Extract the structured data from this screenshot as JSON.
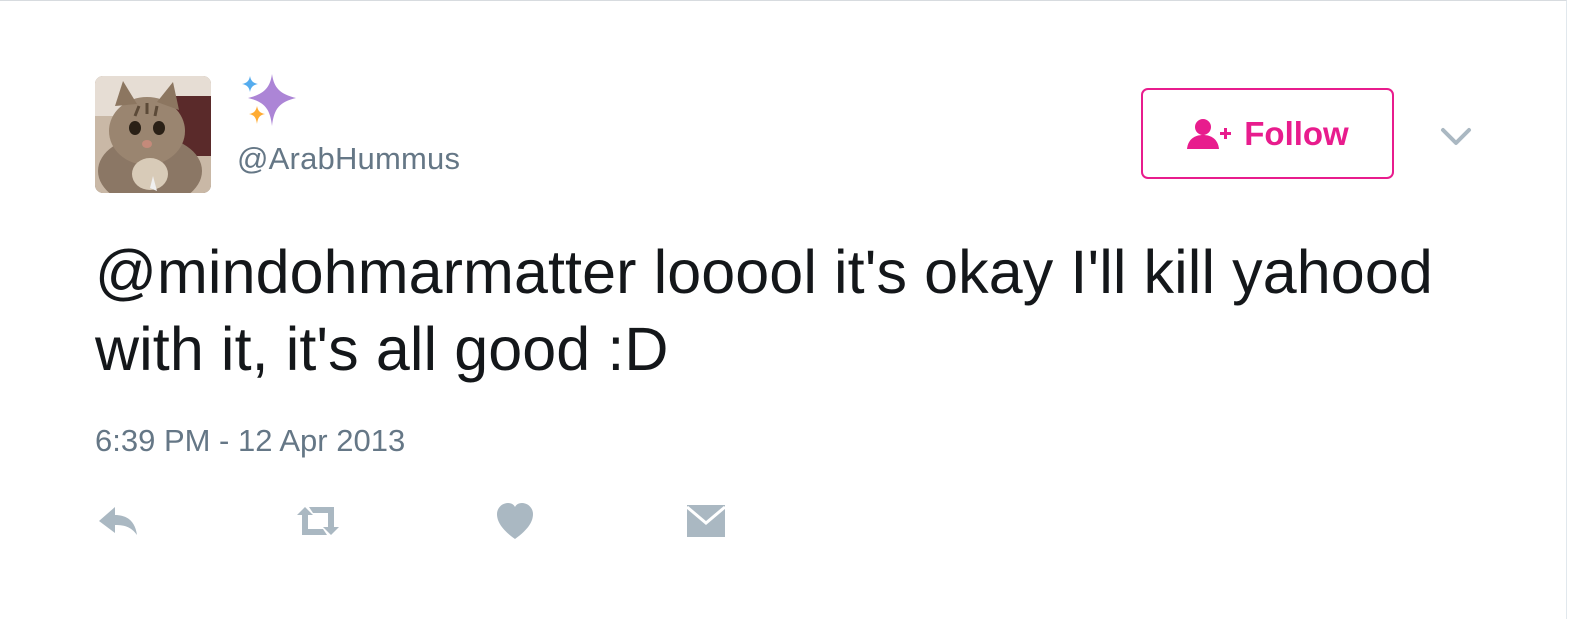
{
  "tweet": {
    "display_name_icon": "sparkles-icon",
    "handle": "@ArabHummus",
    "follow_label": "Follow",
    "follow_icon": "add-user-icon",
    "more_icon": "chevron-down-icon",
    "text": "@mindohmarmatter looool it's okay I'll kill yahood with it, it's all good :D",
    "timestamp": "6:39 PM - 12 Apr 2013"
  },
  "actions": [
    {
      "name": "reply",
      "icon": "reply-icon"
    },
    {
      "name": "retweet",
      "icon": "retweet-icon"
    },
    {
      "name": "like",
      "icon": "heart-icon"
    },
    {
      "name": "direct-message",
      "icon": "envelope-icon"
    }
  ],
  "colors": {
    "accent": "#e81c8d",
    "text": "#14171a",
    "secondary_text": "#657786",
    "action_icon": "#aab8c2"
  }
}
